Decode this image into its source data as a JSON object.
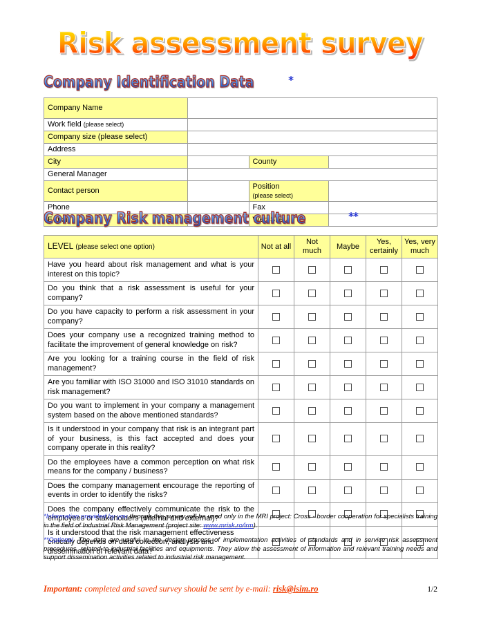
{
  "document": {
    "title": "Risk assessment survey",
    "page_number": "1/2"
  },
  "sections": {
    "company_identification": {
      "heading": "Company Identification Data",
      "superscript": "*"
    },
    "risk_culture": {
      "heading": "Company Risk management culture",
      "superscript": "**"
    }
  },
  "company_table": {
    "rows": [
      {
        "label": "Company Name",
        "sublabel": "",
        "highlight": true,
        "tall": true,
        "split": false
      },
      {
        "label": "Work field",
        "sublabel": "(please select)",
        "highlight": false,
        "tall": false,
        "split": false
      },
      {
        "label": "Company size (please select)",
        "sublabel": "",
        "highlight": true,
        "tall": false,
        "split": false
      },
      {
        "label": "Address",
        "sublabel": "",
        "highlight": false,
        "tall": false,
        "split": false
      },
      {
        "label": "City",
        "sublabel": "",
        "highlight": true,
        "tall": false,
        "split": true,
        "label2": "County",
        "sublabel2": ""
      },
      {
        "label": "General Manager",
        "sublabel": "",
        "highlight": false,
        "tall": false,
        "split": false
      },
      {
        "label": "Contact person",
        "sublabel": "",
        "highlight": true,
        "tall": true,
        "split": true,
        "label2": "Position",
        "sublabel2": "(please select)"
      },
      {
        "label": "Phone",
        "sublabel": "",
        "highlight": false,
        "tall": false,
        "split": true,
        "label2": "Fax",
        "sublabel2": ""
      },
      {
        "label": "E-mail",
        "sublabel": "",
        "highlight": true,
        "tall": false,
        "split": true,
        "label2": "Web Site",
        "sublabel2": ""
      }
    ]
  },
  "culture_table": {
    "level_label": "LEVEL",
    "level_hint": "(please select one option)",
    "options": [
      "Not at all",
      "Not much",
      "Maybe",
      "Yes, certainly",
      "Yes, very much"
    ],
    "questions": [
      {
        "text": "Have you heard about risk management and what is your interest on this topic?",
        "justify": true
      },
      {
        "text": "Do you think that a risk assessment is useful for your company?",
        "justify": true
      },
      {
        "text": "Do you have capacity to perform a risk assessment in your company?",
        "justify": true
      },
      {
        "text": "Does your company use a recognized training method to facilitate the improvement of general knowledge on risk?",
        "justify": true
      },
      {
        "text": "Are you looking for a training course in the field of risk management?",
        "justify": true
      },
      {
        "text": "Are you familiar with ISO 31000 and ISO 31010 standards on risk management?",
        "justify": true
      },
      {
        "text": "Do you want to implement in your company a management system based on the above mentioned standards?",
        "justify": true
      },
      {
        "text": "Is it understood in your company that risk is an integrant part of your business, is this fact accepted and does your company operate in this reality?",
        "justify": true
      },
      {
        "text": "Do the employees have a common perception on what risk means for the company / business?",
        "justify": true
      },
      {
        "text": "Does the company management encourage the reporting of events in order to identify the risks?",
        "justify": true
      },
      {
        "text": "Does the company effectively communicate the risk to the employees or stakeholders (internal and external)?",
        "justify": true
      },
      {
        "text": "Is it understood that the risk management effectiveness critically depends on data collection, analysis and dissemination of relevant data?",
        "justify": false
      }
    ]
  },
  "footnotes": [
    {
      "mark": "*Information provided by you",
      "body_before": " through this survey will be used only in the MRI project: Cross - border cooperation for specialists training in the field of Industrial Risk Management (project site: ",
      "link": "www.mrisk.ro/irm",
      "body_after": ")."
    },
    {
      "mark": "**Optional",
      "body_before": ". The data are useful in the design process of implementation activities of standards and in service risk assessment procedures, related to industrial facilities and equipments. They allow the assessment of information and relevant training needs and support dissemination activities related to industrial risk management.",
      "link": "",
      "body_after": ""
    }
  ],
  "footer": {
    "important_label": "Important:",
    "text_before": " completed and saved survey should be sent by e-mail: ",
    "email": "risk@isim.ro"
  },
  "colors": {
    "highlight_yellow": "#ffff99",
    "heading_blue": "#2f6fd0",
    "heading_outline_red": "#a82820",
    "footer_orange": "#f03c00",
    "link_blue": "#2030d0",
    "border_gray": "#9a9a9a"
  }
}
